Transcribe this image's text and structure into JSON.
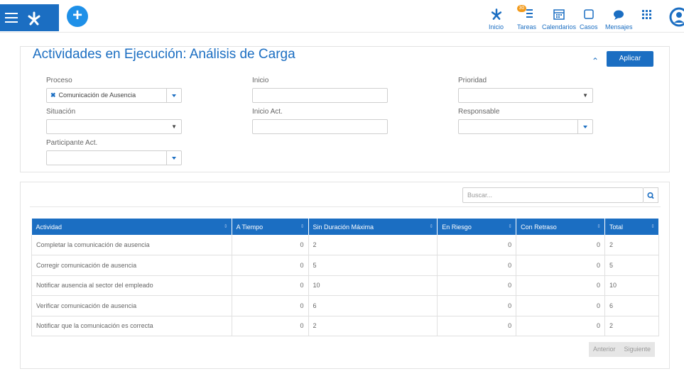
{
  "topbar": {
    "nav": [
      {
        "icon": "process-icon",
        "label": "Inicio"
      },
      {
        "icon": "tasks-icon",
        "label": "Tareas",
        "badge": "30"
      },
      {
        "icon": "calendar-icon",
        "label": "Calendarios"
      },
      {
        "icon": "cases-icon",
        "label": "Casos"
      },
      {
        "icon": "chat-icon",
        "label": "Mensajes"
      },
      {
        "icon": "apps-grid-icon",
        "label": ""
      }
    ],
    "accent": "#1b6ec2"
  },
  "filters": {
    "title": "Actividades en Ejecución: Análisis de Carga",
    "apply_label": "Aplicar",
    "proceso": {
      "label": "Proceso",
      "value": "Comunicación de Ausencia"
    },
    "inicio": {
      "label": "Inicio",
      "value": ""
    },
    "prioridad": {
      "label": "Prioridad",
      "value": ""
    },
    "situacion": {
      "label": "Situación",
      "value": ""
    },
    "inicio_act": {
      "label": "Inicio Act.",
      "value": ""
    },
    "responsable": {
      "label": "Responsable",
      "value": ""
    },
    "participante": {
      "label": "Participante Act.",
      "value": ""
    }
  },
  "results": {
    "search_placeholder": "Buscar...",
    "columns": [
      "Actividad",
      "A Tiempo",
      "Sin Duración Máxima",
      "En Riesgo",
      "Con Retraso",
      "Total"
    ],
    "rows": [
      [
        "Completar la comunicación de ausencia",
        "0",
        "2",
        "0",
        "0",
        "2"
      ],
      [
        "Corregir comunicación de ausencia",
        "0",
        "5",
        "0",
        "0",
        "5"
      ],
      [
        "Notificar ausencia al sector del empleado",
        "0",
        "10",
        "0",
        "0",
        "10"
      ],
      [
        "Verificar comunicación de ausencia",
        "0",
        "6",
        "0",
        "0",
        "6"
      ],
      [
        "Notificar que la comunicación es correcta",
        "0",
        "2",
        "0",
        "0",
        "2"
      ]
    ],
    "prev_label": "Anterior",
    "next_label": "Siguiente"
  }
}
